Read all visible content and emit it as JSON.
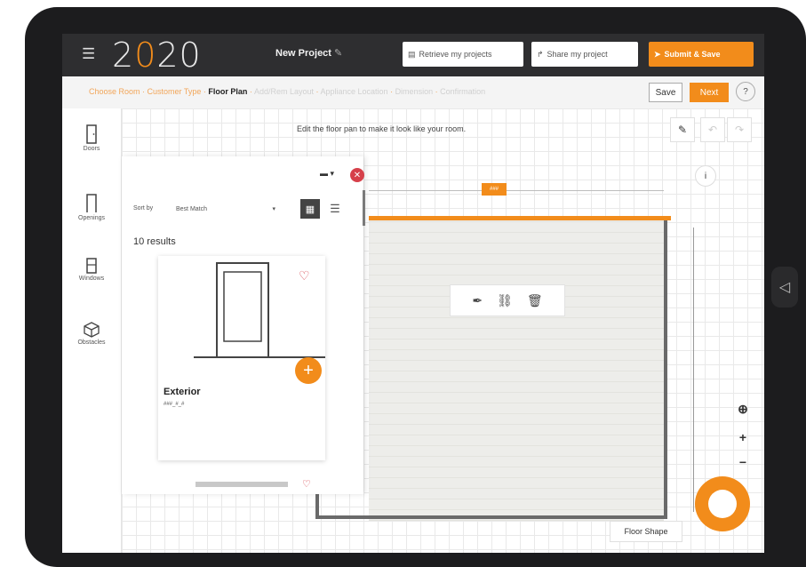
{
  "header": {
    "logo": "2020",
    "project_name": "New Project",
    "retrieve_label": "Retrieve my projects",
    "share_label": "Share my project",
    "submit_label": "Submit & Save"
  },
  "breadcrumb": {
    "steps": [
      "Choose Room",
      "Customer Type",
      "Floor Plan",
      "Add/Rem Layout",
      "Appliance Location",
      "Dimension",
      "Confirmation"
    ],
    "current": "Floor Plan",
    "save_label": "Save",
    "next_label": "Next",
    "help_label": "?"
  },
  "toolbar": {
    "items": [
      {
        "label": "Doors",
        "icon": "door-icon"
      },
      {
        "label": "Openings",
        "icon": "opening-icon"
      },
      {
        "label": "Windows",
        "icon": "window-icon"
      },
      {
        "label": "Obstacles",
        "icon": "obstacle-icon"
      }
    ]
  },
  "canvas": {
    "instruction": "Edit the floor pan to make it look like your room.",
    "dimension_label": "###",
    "floor_shape_label": "Floor Shape",
    "info_label": "i"
  },
  "panel": {
    "sort_label": "Sort by",
    "sort_value": "Best Match",
    "results_count": "10 results",
    "items": [
      {
        "title": "Exterior",
        "code": "###_#_#"
      }
    ]
  },
  "colors": {
    "accent": "#f28c1b",
    "header_bg": "#2e2e30",
    "close_red": "#d6404a"
  }
}
